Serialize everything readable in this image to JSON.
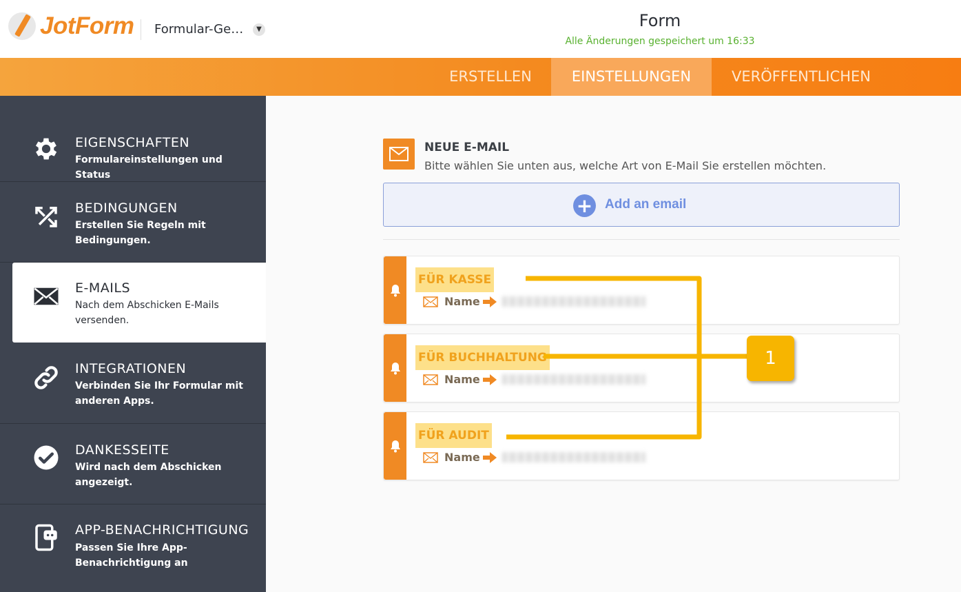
{
  "header": {
    "brand": "JotForm",
    "form_selector": "Formular-Ge…",
    "title": "Form",
    "save_status": "Alle Änderungen gespeichert um 16:33"
  },
  "nav": {
    "tabs": [
      {
        "label": "ERSTELLEN"
      },
      {
        "label": "EINSTELLUNGEN",
        "active": true
      },
      {
        "label": "VERÖFFENTLICHEN"
      }
    ]
  },
  "sidebar": {
    "items": [
      {
        "title": "EIGENSCHAFTEN",
        "desc": "Formulareinstellungen und Status",
        "icon": "gear-icon"
      },
      {
        "title": "BEDINGUNGEN",
        "desc": "Erstellen Sie Regeln mit Bedingungen.",
        "icon": "conditions-icon"
      },
      {
        "title": "E-MAILS",
        "desc": "Nach dem Abschicken E-Mails versenden.",
        "icon": "envelope-icon",
        "active": true
      },
      {
        "title": "INTEGRATIONEN",
        "desc": "Verbinden Sie Ihr Formular mit anderen Apps.",
        "icon": "link-icon"
      },
      {
        "title": "DANKESSEITE",
        "desc": "Wird nach dem Abschicken angezeigt.",
        "icon": "check-circle-icon"
      },
      {
        "title": "APP-BENACHRICHTIGUNG",
        "desc": "Passen Sie Ihre App-Benachrichtigung an",
        "icon": "app-notification-icon"
      }
    ]
  },
  "new_email": {
    "title": "NEUE E-MAIL",
    "subtitle": "Bitte wählen Sie unten aus, welche Art von E-Mail Sie erstellen möchten.",
    "add_button": "Add an email"
  },
  "emails": [
    {
      "title": "FÜR KASSE",
      "from_label": "Name",
      "recipient": "redacted"
    },
    {
      "title": "FÜR BUCHHALTUNG",
      "from_label": "Name",
      "recipient": "redacted"
    },
    {
      "title": "FÜR AUDIT",
      "from_label": "Name",
      "recipient": "redacted"
    }
  ],
  "annotation": {
    "callout_number": "1",
    "color": "#f7b500"
  },
  "colors": {
    "brand_orange": "#f08a24",
    "sidebar_bg": "#3e4450",
    "save_green": "#58b12f",
    "add_blue": "#6f8fe0"
  }
}
